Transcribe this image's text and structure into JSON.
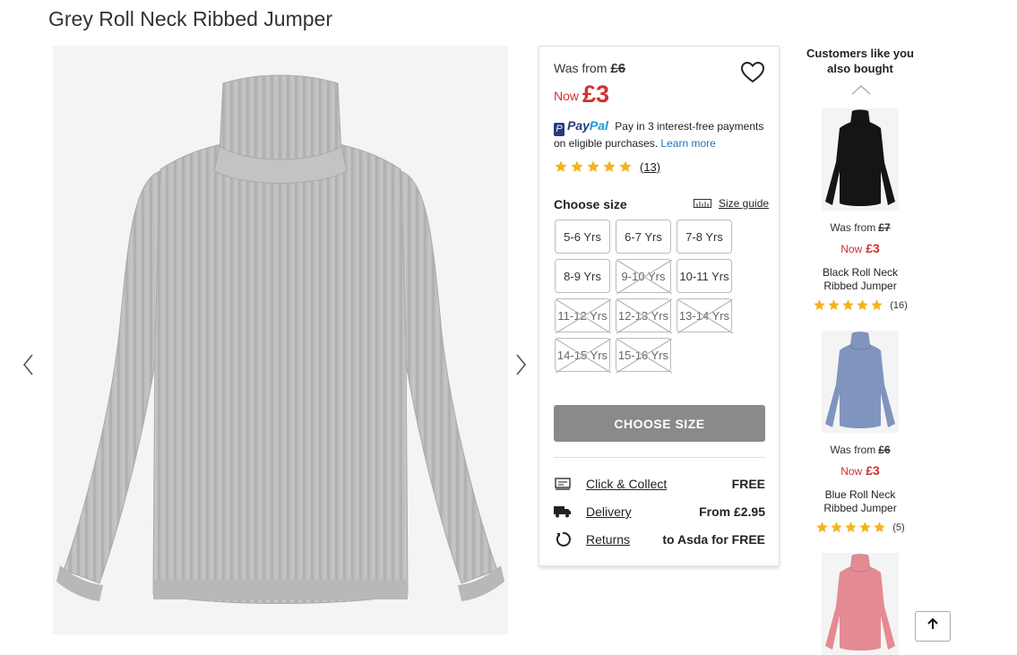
{
  "product": {
    "title": "Grey Roll Neck Ribbed Jumper",
    "was_label": "Was from",
    "was_price": "£6",
    "now_label": "Now",
    "now_price": "£3",
    "rating": 5,
    "review_count": "(13)"
  },
  "paypal": {
    "brand_pay": "Pay",
    "brand_pal": "Pal",
    "text": "Pay in 3 interest-free payments on eligible purchases.",
    "learn_more": "Learn more"
  },
  "sizes": {
    "label": "Choose size",
    "guide": "Size guide",
    "options": [
      {
        "label": "5-6 Yrs",
        "available": true
      },
      {
        "label": "6-7 Yrs",
        "available": true
      },
      {
        "label": "7-8 Yrs",
        "available": true
      },
      {
        "label": "8-9 Yrs",
        "available": true
      },
      {
        "label": "9-10 Yrs",
        "available": false
      },
      {
        "label": "10-11 Yrs",
        "available": true
      },
      {
        "label": "11-12 Yrs",
        "available": false
      },
      {
        "label": "12-13 Yrs",
        "available": false
      },
      {
        "label": "13-14 Yrs",
        "available": false
      },
      {
        "label": "14-15 Yrs",
        "available": false
      },
      {
        "label": "15-16 Yrs",
        "available": false
      }
    ]
  },
  "cta": {
    "label": "CHOOSE SIZE"
  },
  "delivery": [
    {
      "icon": "click-collect-icon",
      "label": "Click & Collect",
      "value": "FREE"
    },
    {
      "icon": "delivery-truck-icon",
      "label": "Delivery",
      "value": "From £2.95"
    },
    {
      "icon": "returns-icon",
      "label": "Returns",
      "value": "to Asda for FREE"
    }
  ],
  "recommendations": {
    "title": "Customers like you also bought",
    "items": [
      {
        "color": "#151515",
        "was_label": "Was from",
        "was_price": "£7",
        "now_label": "Now",
        "now_price": "£3",
        "name": "Black Roll Neck Ribbed Jumper",
        "rating": 5,
        "count": "(16)"
      },
      {
        "color": "#7f95bf",
        "was_label": "Was from",
        "was_price": "£6",
        "now_label": "Now",
        "now_price": "£3",
        "name": "Blue Roll Neck Ribbed Jumper",
        "rating": 5,
        "count": "(5)"
      },
      {
        "color": "#e48a92"
      }
    ]
  },
  "colors": {
    "sale_red": "#d32f2f",
    "star_yellow": "#f5b31b",
    "button_grey": "#8a8a8a",
    "jumper_grey": "#bdbdbd"
  }
}
